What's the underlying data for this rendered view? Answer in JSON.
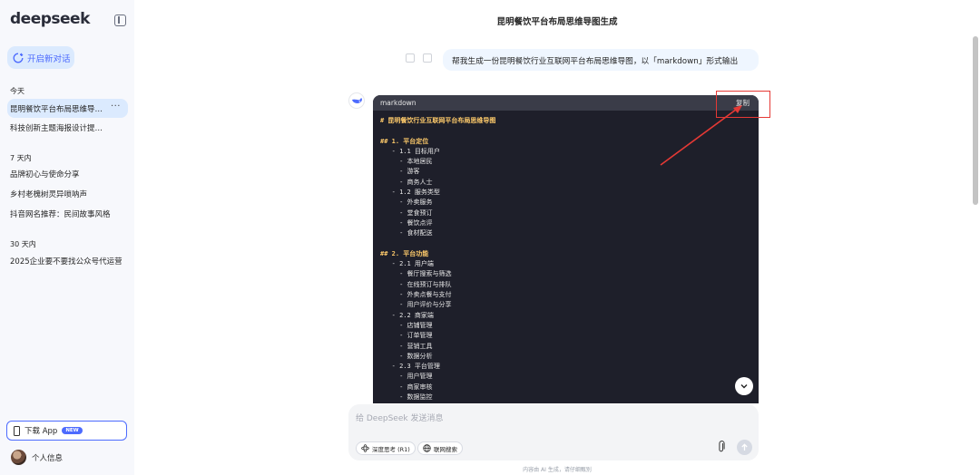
{
  "sidebar": {
    "logo": "deepseek",
    "new_chat_label": "开启新对话",
    "sections": [
      {
        "label": "今天",
        "items": [
          {
            "label": "昆明餐饮平台布局思维导图生成",
            "active": true
          },
          {
            "label": "科技创新主题海报设计提示词"
          }
        ]
      },
      {
        "label": "7 天内",
        "items": [
          {
            "label": "品牌初心与使命分享"
          },
          {
            "label": "乡村老槐树灵异唢呐声"
          },
          {
            "label": "抖音网名推荐：民间故事风格"
          }
        ]
      },
      {
        "label": "30 天内",
        "items": [
          {
            "label": "2025企业要不要找公众号代运营"
          }
        ]
      }
    ],
    "more_glyph": "···",
    "download_label": "下载 App",
    "download_badge": "NEW",
    "profile_label": "个人信息"
  },
  "main": {
    "title": "昆明餐饮平台布局思维导图生成",
    "user_message": "帮我生成一份昆明餐饮行业互联网平台布局思维导图，以「markdown」形式输出",
    "code_block": {
      "language": "markdown",
      "copy_label": "复制",
      "lines": [
        {
          "kind": "h",
          "text": "# 昆明餐饮行业互联网平台布局思维导图"
        },
        {
          "kind": "blank",
          "text": ""
        },
        {
          "kind": "hs",
          "text": "## 1. 平台定位"
        },
        {
          "kind": "n",
          "text": "   - 1.1 目标用户"
        },
        {
          "kind": "n",
          "text": "     - 本地居民"
        },
        {
          "kind": "n",
          "text": "     - 游客"
        },
        {
          "kind": "n",
          "text": "     - 商务人士"
        },
        {
          "kind": "n",
          "text": "   - 1.2 服务类型"
        },
        {
          "kind": "n",
          "text": "     - 外卖服务"
        },
        {
          "kind": "n",
          "text": "     - 堂食预订"
        },
        {
          "kind": "n",
          "text": "     - 餐饮点评"
        },
        {
          "kind": "n",
          "text": "     - 食材配送"
        },
        {
          "kind": "blank",
          "text": ""
        },
        {
          "kind": "hs",
          "text": "## 2. 平台功能"
        },
        {
          "kind": "n",
          "text": "   - 2.1 用户端"
        },
        {
          "kind": "n",
          "text": "     - 餐厅搜索与筛选"
        },
        {
          "kind": "n",
          "text": "     - 在线预订与排队"
        },
        {
          "kind": "n",
          "text": "     - 外卖点餐与支付"
        },
        {
          "kind": "n",
          "text": "     - 用户评价与分享"
        },
        {
          "kind": "n",
          "text": "   - 2.2 商家端"
        },
        {
          "kind": "n",
          "text": "     - 店铺管理"
        },
        {
          "kind": "n",
          "text": "     - 订单管理"
        },
        {
          "kind": "n",
          "text": "     - 营销工具"
        },
        {
          "kind": "n",
          "text": "     - 数据分析"
        },
        {
          "kind": "n",
          "text": "   - 2.3 平台管理"
        },
        {
          "kind": "n",
          "text": "     - 用户管理"
        },
        {
          "kind": "n",
          "text": "     - 商家审核"
        },
        {
          "kind": "n",
          "text": "     - 数据监控"
        }
      ]
    }
  },
  "input": {
    "placeholder": "给 DeepSeek 发送消息",
    "deep_think_label": "深度思考 (R1)",
    "web_search_label": "联网搜索"
  },
  "footer_note": "内容由 AI 生成，请仔细甄别",
  "colors": {
    "accent": "#4d6bfe",
    "highlight": "#e53935",
    "code_bg": "#1e1f2a"
  }
}
